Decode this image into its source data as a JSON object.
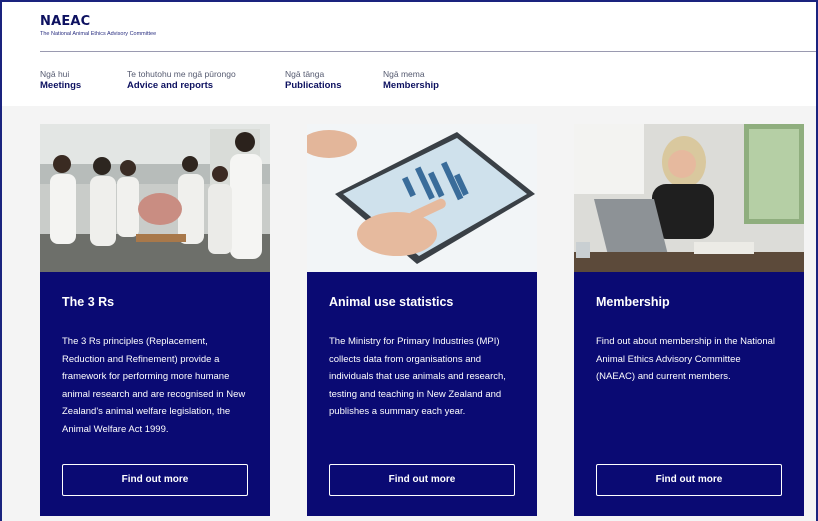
{
  "brand": {
    "name": "NAEAC",
    "subtitle": "The National Animal Ethics Advisory Committee"
  },
  "nav": [
    {
      "maori": "Ngā hui",
      "label": "Meetings"
    },
    {
      "maori": "Te tohutohu me ngā pūrongo",
      "label": "Advice and reports"
    },
    {
      "maori": "Ngā tānga",
      "label": "Publications"
    },
    {
      "maori": "Ngā mema",
      "label": "Membership"
    }
  ],
  "cards": [
    {
      "title": "The 3 Rs",
      "body": "The 3 Rs principles (Replacement, Reduction and Refinement) provide a framework for performing more humane animal research and are recognised in New Zealand's animal welfare legislation, the Animal Welfare Act 1999.",
      "button": "Find out more",
      "image": "lab-students-photo"
    },
    {
      "title": "Animal use statistics",
      "body": "The Ministry for Primary Industries (MPI) collects data from organisations and individuals that use animals and research, testing and teaching in New Zealand and publishes a summary each year.",
      "button": "Find out more",
      "image": "tablet-chart-photo"
    },
    {
      "title": "Membership",
      "body": "Find out about membership in the National Animal Ethics Advisory Committee (NAEAC) and current members.",
      "button": "Find out more",
      "image": "woman-at-desk-photo"
    }
  ],
  "colors": {
    "card_bg": "#0a0a73",
    "brand": "#0d1160",
    "page_bg": "#f4f4f4"
  }
}
